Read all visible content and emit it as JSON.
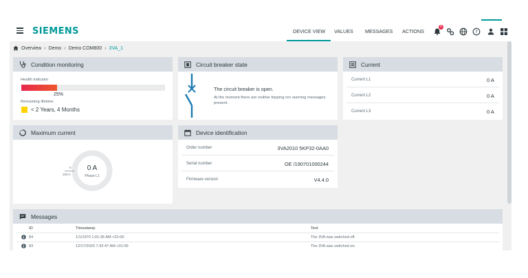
{
  "appbar": {
    "logo": "SIEMENS",
    "tabs": [
      "DEVICE VIEW",
      "VALUES",
      "MESSAGES",
      "ACTIONS"
    ],
    "active_tab": "DEVICE VIEW",
    "notification_count": "6",
    "icons": [
      "bell-icon",
      "settings-icon",
      "globe-icon",
      "help-icon",
      "user-icon",
      "apps-icon"
    ]
  },
  "breadcrumb": {
    "items": [
      "Overview",
      "Demo",
      "Demo COM800",
      "3VA_1"
    ]
  },
  "condition": {
    "title": "Condition monitoring",
    "health_label": "Health indicator",
    "health_value": "25%",
    "health_fraction": 0.25,
    "lifetime_label": "Remaining lifetime",
    "lifetime_value": "< 2 Years, 4 Months",
    "lifetime_color": "#ffd200"
  },
  "breaker": {
    "title": "Circuit breaker state",
    "state_text": "The circuit breaker is open.",
    "detail_text": "At the moment there are neither tripping nor warning messages present."
  },
  "current": {
    "title": "Current",
    "rows": [
      {
        "label": "Current L1",
        "value": "0 A"
      },
      {
        "label": "Current L2",
        "value": "0 A"
      },
      {
        "label": "Current L3",
        "value": "0 A"
      }
    ]
  },
  "max_current": {
    "title": "Maximum current",
    "value": "0 A",
    "phase": "Phase L1",
    "scale_top": "0",
    "scale_value": "100 A"
  },
  "device_id": {
    "title": "Device identification",
    "rows": [
      {
        "label": "Order number",
        "value": "3VA2010 5KP32-0AA0"
      },
      {
        "label": "Serial number",
        "value": "OE /190701000244"
      },
      {
        "label": "Firmware version",
        "value": "V4.4.0"
      }
    ]
  },
  "messages": {
    "title": "Messages",
    "columns": [
      "ID",
      "Timestamp",
      "Text"
    ],
    "rows": [
      {
        "id": "84",
        "timestamp": "1/1/1970 1:01:36 AM +01:00",
        "text": "The 3VA was switched off."
      },
      {
        "id": "83",
        "timestamp": "12/17/2020 7:42:47 AM +01:00",
        "text": "The 3VA was switched on."
      }
    ]
  },
  "colors": {
    "accent": "#009999",
    "header_bg": "#d7dde2",
    "page_bg": "#f0f0f0",
    "breaker_line": "#1a7ab0"
  }
}
